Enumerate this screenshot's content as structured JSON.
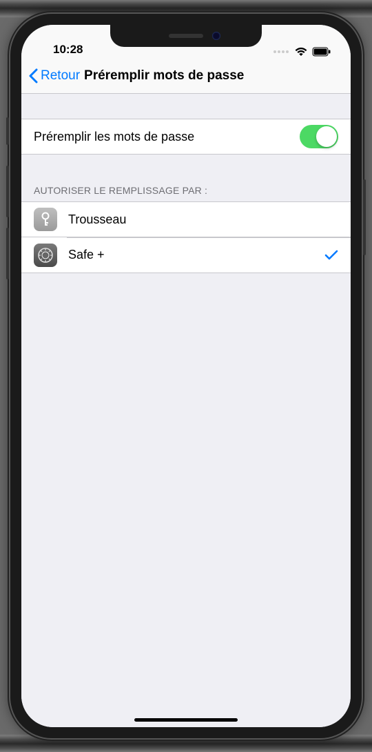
{
  "statusBar": {
    "time": "10:28"
  },
  "nav": {
    "back": "Retour",
    "title": "Préremplir mots de passe"
  },
  "toggleRow": {
    "label": "Préremplir les mots de passe",
    "on": true
  },
  "providersHeader": "AUTORISER LE REMPLISSAGE PAR :",
  "providers": [
    {
      "label": "Trousseau",
      "icon": "keychain",
      "selected": false
    },
    {
      "label": "Safe +",
      "icon": "safe",
      "selected": true
    }
  ],
  "colors": {
    "tint": "#007aff",
    "toggleOn": "#4cd964",
    "bg": "#efeff4"
  }
}
